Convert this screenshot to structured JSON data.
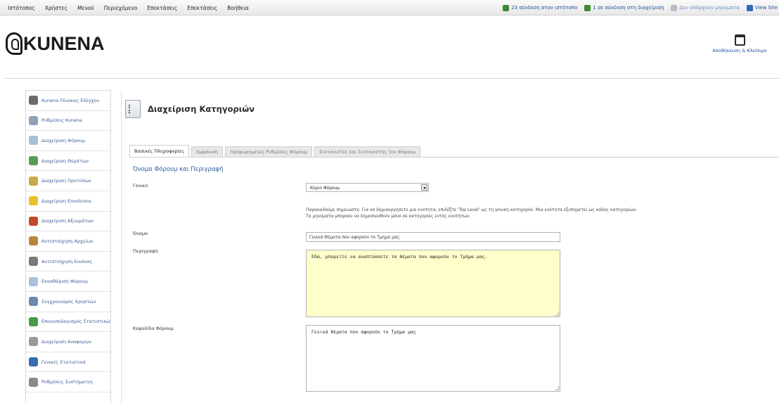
{
  "topbar": {
    "menu": [
      "Ιστότοπος",
      "Χρήστες",
      "Μενού",
      "Περιεχόμενο",
      "Επεκτάσεις",
      "Επεκτάσεις",
      "Βοήθεια"
    ],
    "status": [
      {
        "icon": "users-icon",
        "label": "23 σύνδεση στον ιστότοπο",
        "color": "#3a8a3a"
      },
      {
        "icon": "user-icon",
        "label": "1 σε σύνδεση στη διαχείριση",
        "color": "#3a8a3a"
      },
      {
        "icon": "mail-icon",
        "label": "Δεν υπάρχουν μηνύματα",
        "color": "#9a9a9a"
      },
      {
        "icon": "monitor-icon",
        "label": "View Site",
        "color": "#2e6ab8"
      }
    ]
  },
  "header": {
    "logo_text": "KUNENA",
    "action_icon": "calendar-icon",
    "action_label": "Αποθήκευση & Κλείσιμο"
  },
  "sidebar": {
    "items": [
      {
        "label": "Kunena Πίνακας Ελέγχου",
        "icon": "kunena-icon",
        "color": "#6a6a6a"
      },
      {
        "label": "Ρυθμίσεις Kunena",
        "icon": "tools-icon",
        "color": "#8fa3b8"
      },
      {
        "label": "Διαχείριση Φόρουμ",
        "icon": "forum-icon",
        "color": "#a9bfd8"
      },
      {
        "label": "Διαχείριση Θεμάτων",
        "icon": "topics-icon",
        "color": "#5a9a5a"
      },
      {
        "label": "Διαχείριση Προτύπων",
        "icon": "templates-icon",
        "color": "#c9a94a"
      },
      {
        "label": "Διαχείριση Emoticons",
        "icon": "smiley-icon",
        "color": "#e8c22a"
      },
      {
        "label": "Διαχείριση Αξιωμάτων",
        "icon": "ranks-icon",
        "color": "#c24a2a"
      },
      {
        "label": "Αντιστοίχηση Αρχείων",
        "icon": "files-icon",
        "color": "#b8863a"
      },
      {
        "label": "Αντιστοίχηση Εικόνας",
        "icon": "image-icon",
        "color": "#7a7a7a"
      },
      {
        "label": "Εκκαθάριση Φόρουμ",
        "icon": "prune-icon",
        "color": "#aac0dc"
      },
      {
        "label": "Συγχρονισμός Χρηστών",
        "icon": "sync-users-icon",
        "color": "#6a8ab0"
      },
      {
        "label": "Επανυπολογισμός Στατιστικών",
        "icon": "stats-icon",
        "color": "#4a9a4a"
      },
      {
        "label": "Διαχείριση Αναφορών",
        "icon": "reports-icon",
        "color": "#9a9a9a"
      },
      {
        "label": "Γενικές Στατιστικά",
        "icon": "chart-icon",
        "color": "#3a6ab0"
      },
      {
        "label": "Ρυθμίσεις Συστήματος",
        "icon": "settings-icon",
        "color": "#8a8a8a"
      }
    ]
  },
  "main": {
    "title": "Διαχείριση Κατηγοριών",
    "tabs": [
      "Βασικές Πληροφορίες",
      "Εμφάνιση",
      "Προχωρημένες Ρυθμίσεις Φόρουμ",
      "Συντονιστές και Συντονιστής του Φόρουμ"
    ],
    "section_title": "Όνομα Φόρουμ και Περιγραφή",
    "fields": {
      "parent_label": "Γονικό",
      "parent_value": "Κύριο Φόρουμ",
      "hint_line1": "Παρακαλούμε σημειώστε: Για να δημιουργήσετε μια ενότητα, επιλέξτε 'Top Level' ως τη γονική κατηγορία. Μια ενότητα εξυπηρετεί ως κάδος κατηγοριών.",
      "hint_line2": "Τα μηνύματα μπορούν να δημοσιευθούν μόνο σε κατηγορίες εντός ενοτήτων.",
      "name_label": "Όνομα",
      "name_value": "Γενικά Θέματα που αφορούν το Τμήμα μας",
      "description_label": "Περιγραφή",
      "description_value": "Εδώ, μπορείτε να αναπτύσσετε τα θέματα που αφορούν το Τμήμα μας.",
      "header_label": "Κεφαλίδα Φόρουμ",
      "header_value": "Γενικά Θέματα που αφορούν το Τμήμα μας"
    }
  }
}
